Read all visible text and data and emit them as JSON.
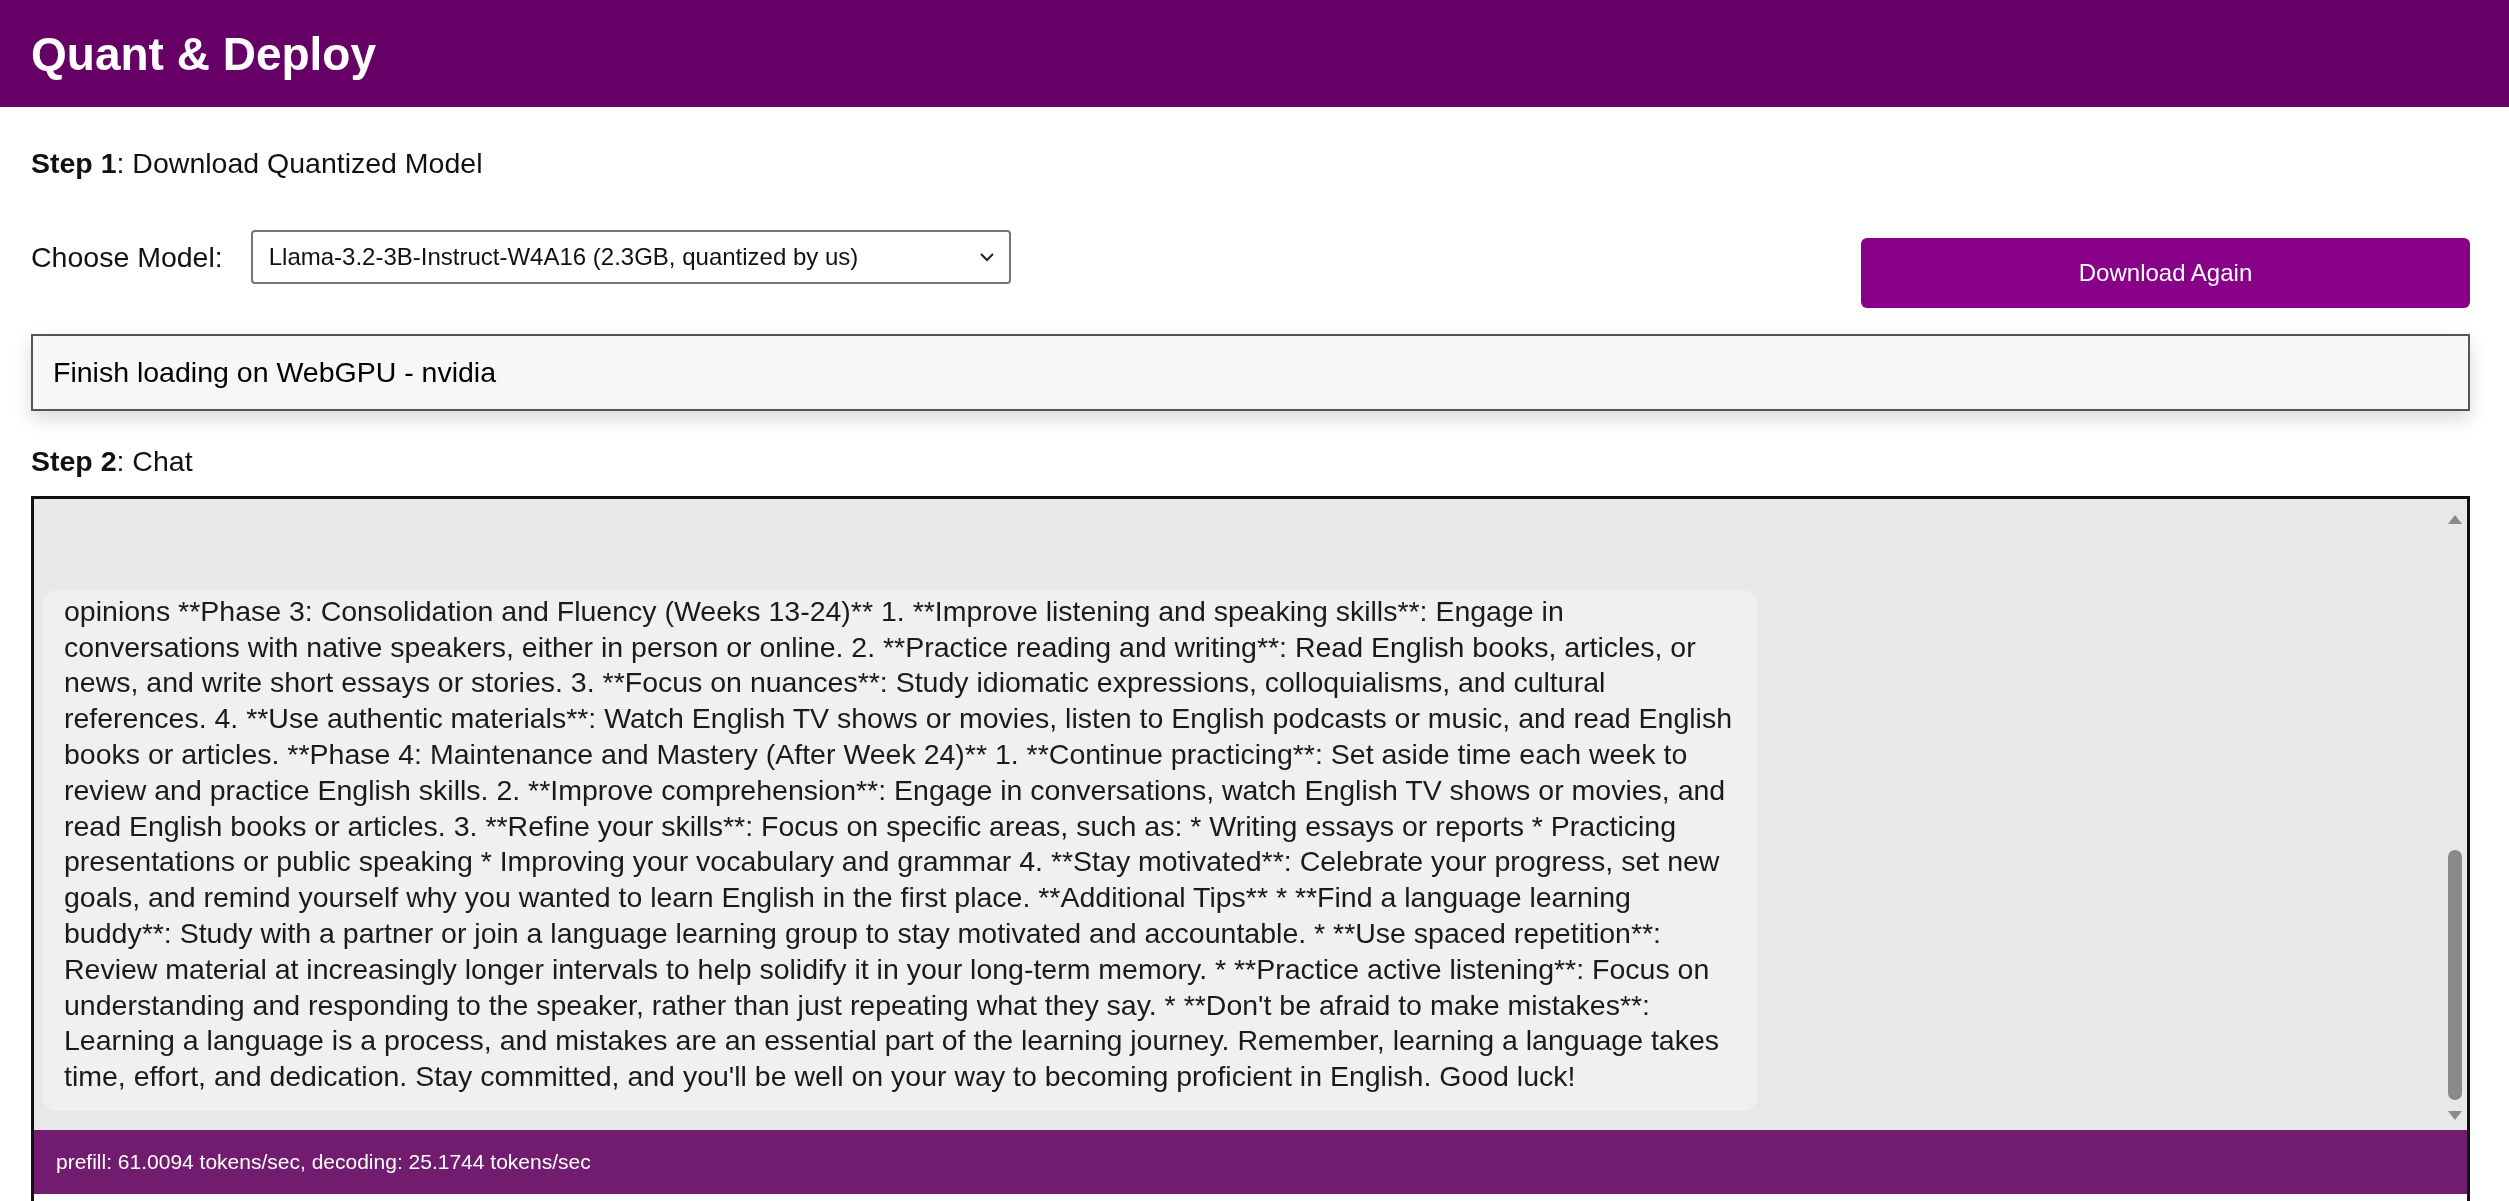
{
  "header": {
    "title": "Quant & Deploy"
  },
  "step1": {
    "heading": "**Step 1**: Download Quantized Model",
    "model_label": "Choose Model:",
    "model_value": "Llama-3.2-3B-Instruct-W4A16 (2.3GB, quantized by us)",
    "button": "Download Again",
    "status": "Finish loading on WebGPU - nvidia"
  },
  "step2": {
    "heading": "**Step 2**: Chat"
  },
  "chat": {
    "messages": [
      {
        "text": "opinions **Phase 3: Consolidation and Fluency (Weeks 13-24)** 1. **Improve listening and speaking skills**: Engage in conversations with native speakers, either in person or online. 2. **Practice reading and writing**: Read English books, articles, or news, and write short essays or stories. 3. **Focus on nuances**: Study idiomatic expressions, colloquialisms, and cultural references. 4. **Use authentic materials**: Watch English TV shows or movies, listen to English podcasts or music, and read English books or articles. **Phase 4: Maintenance and Mastery (After Week 24)** 1. **Continue practicing**: Set aside time each week to review and practice English skills. 2. **Improve comprehension**: Engage in conversations, watch English TV shows or movies, and read English books or articles. 3. **Refine your skills**: Focus on specific areas, such as: * Writing essays or reports * Practicing presentations or public speaking * Improving your vocabulary and grammar 4. **Stay motivated**: Celebrate your progress, set new goals, and remind yourself why you wanted to learn English in the first place. **Additional Tips** * **Find a language learning buddy**: Study with a partner or join a language learning group to stay motivated and accountable. * **Use spaced repetition**: Review material at increasingly longer intervals to help solidify it in your long-term memory. * **Practice active listening**: Focus on understanding and responding to the speaker, rather than just repeating what they say. * **Don't be afraid to make mistakes**: Learning a language is a process, and mistakes are an essential part of the learning journey. Remember, learning a language takes time, effort, and dedication. Stay committed, and you'll be well on your way to becoming proficient in English. Good luck!"
      }
    ],
    "stats": "prefill: 61.0094 tokens/sec, decoding: 25.1744 tokens/sec"
  }
}
